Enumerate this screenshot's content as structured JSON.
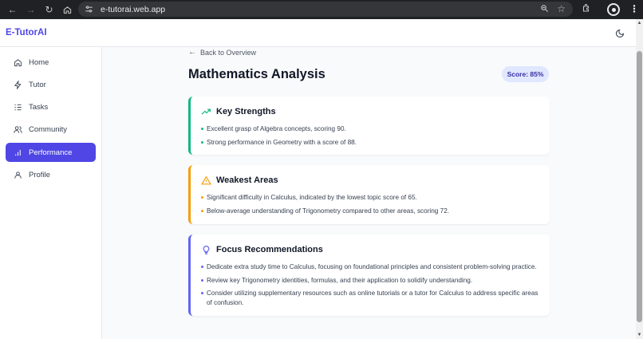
{
  "browser": {
    "url": "e-tutorai.web.app"
  },
  "app": {
    "brand": "E-TutorAI"
  },
  "sidebar": {
    "items": [
      {
        "label": "Home",
        "icon": "home-icon"
      },
      {
        "label": "Tutor",
        "icon": "bolt-icon"
      },
      {
        "label": "Tasks",
        "icon": "list-icon"
      },
      {
        "label": "Community",
        "icon": "users-icon"
      },
      {
        "label": "Performance",
        "icon": "bar-chart-icon",
        "active": true
      },
      {
        "label": "Profile",
        "icon": "user-icon"
      }
    ]
  },
  "main": {
    "back_label": "Back to Overview",
    "title": "Mathematics Analysis",
    "score_label": "Score: 85%",
    "cards": [
      {
        "title": "Key Strengths",
        "icon": "trending-up-icon",
        "accent": "#10b981",
        "items": [
          "Excellent grasp of Algebra concepts, scoring 90.",
          "Strong performance in Geometry with a score of 88."
        ]
      },
      {
        "title": "Weakest Areas",
        "icon": "warning-triangle-icon",
        "accent": "#f59e0b",
        "items": [
          "Significant difficulty in Calculus, indicated by the lowest topic score of 65.",
          "Below-average understanding of Trigonometry compared to other areas, scoring 72."
        ]
      },
      {
        "title": "Focus Recommendations",
        "icon": "lightbulb-icon",
        "accent": "#6366f1",
        "items": [
          "Dedicate extra study time to Calculus, focusing on foundational principles and consistent problem-solving practice.",
          "Review key Trigonometry identities, formulas, and their application to solidify understanding.",
          "Consider utilizing supplementary resources such as online tutorials or a tutor for Calculus to address specific areas of confusion."
        ]
      }
    ]
  },
  "colors": {
    "brand": "#4f46e5",
    "active_nav": "#4f46e5",
    "score_badge_bg": "#e0e7ff",
    "score_badge_text": "#3730a3"
  }
}
